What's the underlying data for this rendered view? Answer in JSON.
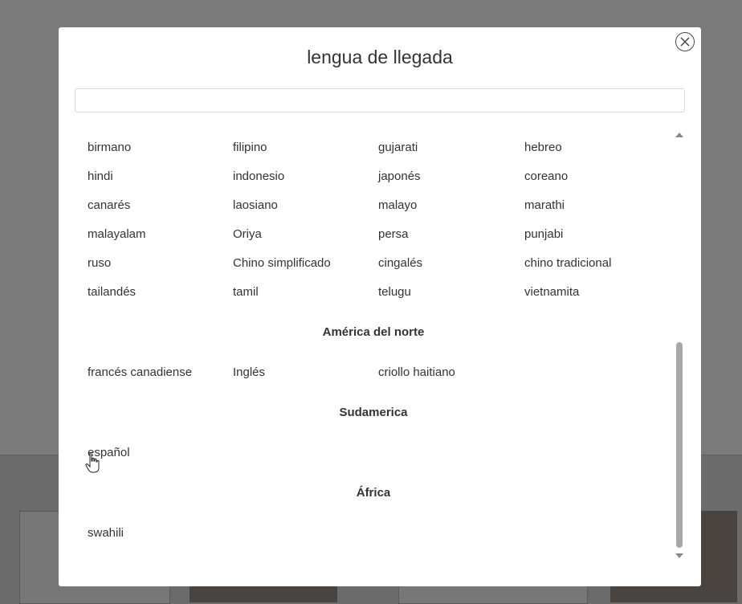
{
  "modal": {
    "title": "lengua de llegada",
    "search": {
      "value": "",
      "placeholder": ""
    }
  },
  "rows_top": [
    [
      "birmano",
      "filipino",
      "gujarati",
      "hebreo"
    ],
    [
      "hindi",
      "indonesio",
      "japonés",
      "coreano"
    ],
    [
      "canarés",
      "laosiano",
      "malayo",
      "marathi"
    ],
    [
      "malayalam",
      "Oriya",
      "persa",
      "punjabi"
    ],
    [
      "ruso",
      "Chino simplificado",
      "cingalés",
      "chino tradicional"
    ],
    [
      "tailandés",
      "tamil",
      "telugu",
      "vietnamita"
    ]
  ],
  "regions": [
    {
      "name": "América del norte",
      "languages": [
        "francés canadiense",
        "Inglés",
        "criollo haitiano"
      ]
    },
    {
      "name": "Sudamerica",
      "languages": [
        "español"
      ]
    },
    {
      "name": "África",
      "languages": [
        "swahili"
      ]
    }
  ],
  "icons": {
    "close": "close-icon",
    "scroll_up": "scroll-up-arrow-icon",
    "scroll_down": "scroll-down-arrow-icon",
    "cursor": "hand-pointer-cursor-icon"
  }
}
